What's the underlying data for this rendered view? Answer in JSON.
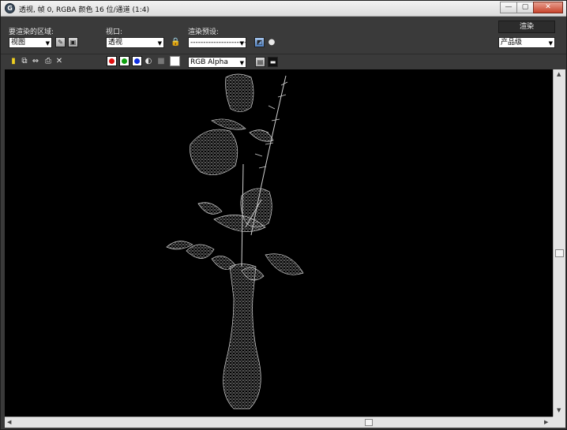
{
  "window": {
    "title": "透视, 帧 0, RGBA 颜色 16 位/通道 (1:4)",
    "buttons": {
      "minimize": "—",
      "maximize": "▢",
      "close": "✕"
    }
  },
  "controls": {
    "area_label": "要渲染的区域:",
    "area_value": "视图",
    "viewport_label": "视口:",
    "viewport_value": "透视",
    "preset_label": "渲染预设:",
    "preset_value": "-------------------------",
    "render_button": "渲染",
    "quality_value": "产品级"
  },
  "toolbar": {
    "channel_value": "RGB Alpha",
    "colors": {
      "red": "#e01010",
      "green": "#10a010",
      "blue": "#1030e0"
    }
  },
  "icons": [
    "save-icon",
    "copy-icon",
    "clone-icon",
    "print-icon",
    "clear-icon",
    "region-edit-icon",
    "region-auto-icon",
    "lock-icon",
    "environment-icon",
    "teapot-icon",
    "monochrome-icon",
    "alpha-icon",
    "display-icon",
    "panel-icon"
  ]
}
